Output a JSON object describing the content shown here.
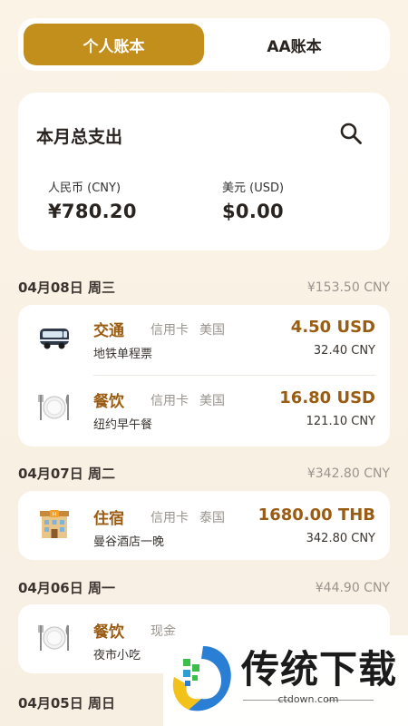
{
  "tabs": [
    {
      "label": "个人账本",
      "active": true
    },
    {
      "label": "AA账本",
      "active": false
    }
  ],
  "summary": {
    "title": "本月总支出",
    "cny": {
      "label": "人民币 (CNY)",
      "value": "¥780.20"
    },
    "usd": {
      "label": "美元 (USD)",
      "value": "$0.00"
    }
  },
  "days": [
    {
      "date": "04月08日 周三",
      "total": "¥153.50 CNY",
      "entries": [
        {
          "icon": "bus-icon",
          "category": "交通",
          "tags": [
            "信用卡",
            "美国"
          ],
          "desc": "地铁单程票",
          "amount": "4.50 USD",
          "cny": "32.40 CNY"
        },
        {
          "icon": "plate-icon",
          "category": "餐饮",
          "tags": [
            "信用卡",
            "美国"
          ],
          "desc": "纽约早午餐",
          "amount": "16.80 USD",
          "cny": "121.10 CNY"
        }
      ]
    },
    {
      "date": "04月07日 周二",
      "total": "¥342.80 CNY",
      "entries": [
        {
          "icon": "hotel-icon",
          "category": "住宿",
          "tags": [
            "信用卡",
            "泰国"
          ],
          "desc": "曼谷酒店一晚",
          "amount": "1680.00 THB",
          "cny": "342.80 CNY"
        }
      ]
    },
    {
      "date": "04月06日 周一",
      "total": "¥44.90 CNY",
      "entries": [
        {
          "icon": "plate-icon",
          "category": "餐饮",
          "tags": [
            "现金"
          ],
          "desc": "夜市小吃",
          "amount": "",
          "cny": ""
        }
      ]
    },
    {
      "date": "04月05日 周日",
      "total": "",
      "entries": []
    }
  ],
  "watermark": {
    "text": "传统下载",
    "url": "ctdown.com"
  },
  "colors": {
    "accent": "#c28e1c",
    "amount": "#9a5b12",
    "background": "#f8efe3"
  }
}
